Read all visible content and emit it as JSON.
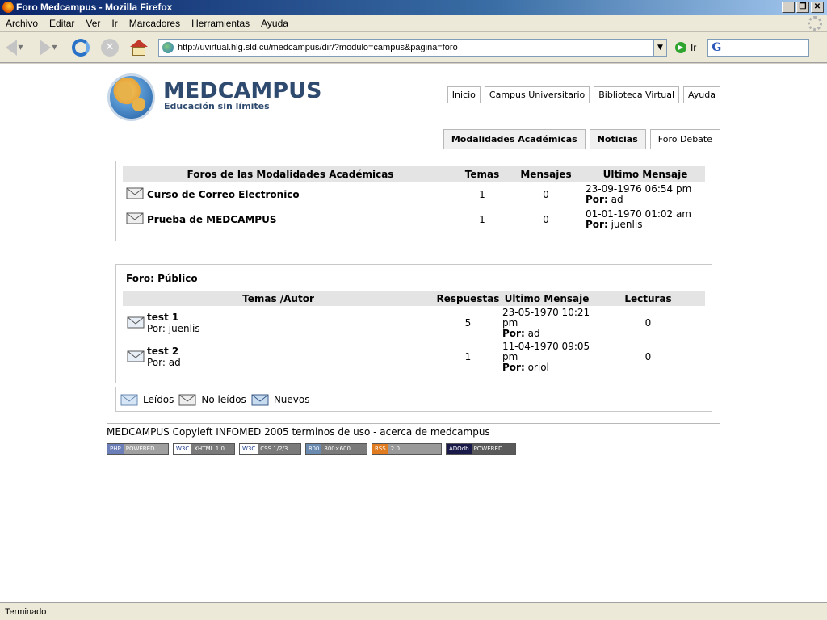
{
  "window": {
    "title": "Foro Medcampus - Mozilla Firefox"
  },
  "menu": [
    "Archivo",
    "Editar",
    "Ver",
    "Ir",
    "Marcadores",
    "Herramientas",
    "Ayuda"
  ],
  "toolbar": {
    "url": "http://uvirtual.hlg.sld.cu/medcampus/dir/?modulo=campus&pagina=foro",
    "go_label": "Ir",
    "search_engine": "G"
  },
  "site": {
    "brand": "MEDCAMPUS",
    "tagline": "Educación sin límites",
    "topnav": [
      "Inicio",
      "Campus Universitario",
      "Biblioteca Virtual",
      "Ayuda"
    ],
    "tabs": [
      "Modalidades Académicas",
      "Noticias",
      "Foro Debate"
    ]
  },
  "forums_table": {
    "headers": [
      "Foros de las Modalidades Académicas",
      "Temas",
      "Mensajes",
      "Ultimo Mensaje"
    ],
    "rows": [
      {
        "name": "Curso de Correo Electronico",
        "temas": "1",
        "mensajes": "0",
        "last_date": "23-09-1976 06:54 pm",
        "por_label": "Por:",
        "por_user": "ad"
      },
      {
        "name": "Prueba de MEDCAMPUS",
        "temas": "1",
        "mensajes": "0",
        "last_date": "01-01-1970 01:02 am",
        "por_label": "Por:",
        "por_user": "juenlis"
      }
    ]
  },
  "topics": {
    "foro_title": "Foro: Público",
    "headers": [
      "Temas /Autor",
      "Respuestas",
      "Ultimo Mensaje",
      "Lecturas"
    ],
    "rows": [
      {
        "title": "test 1",
        "author": "Por: juenlis",
        "respuestas": "5",
        "last_line1": "23-05-1970 10:21",
        "last_line2": "pm",
        "por_label": "Por:",
        "por_user": "ad",
        "lecturas": "0"
      },
      {
        "title": "test 2",
        "author": "Por: ad",
        "respuestas": "1",
        "last_line1": "11-04-1970 09:05",
        "last_line2": "pm",
        "por_label": "Por:",
        "por_user": "oriol",
        "lecturas": "0"
      }
    ]
  },
  "legend": [
    "Leídos",
    "No leídos",
    "Nuevos"
  ],
  "footer": {
    "text": "MEDCAMPUS Copyleft INFOMED 2005 terminos de uso - acerca de medcampus",
    "badges": [
      {
        "left": "PHP",
        "right": "POWERED",
        "color": "#6c7eb7"
      },
      {
        "left": "W3C",
        "right": "XHTML 1.0",
        "color": "#7a7a7a"
      },
      {
        "left": "W3C",
        "right": "CSS 1/2/3",
        "color": "#7a7a7a"
      },
      {
        "left": "800",
        "right": "800×600",
        "color": "#7a7a7a"
      },
      {
        "left": "RSS",
        "right": "2.0",
        "color": "#e07b20"
      },
      {
        "left": "ADOdb",
        "right": "POWERED",
        "color": "#1a1a4a"
      }
    ]
  },
  "status": {
    "text": "Terminado"
  }
}
